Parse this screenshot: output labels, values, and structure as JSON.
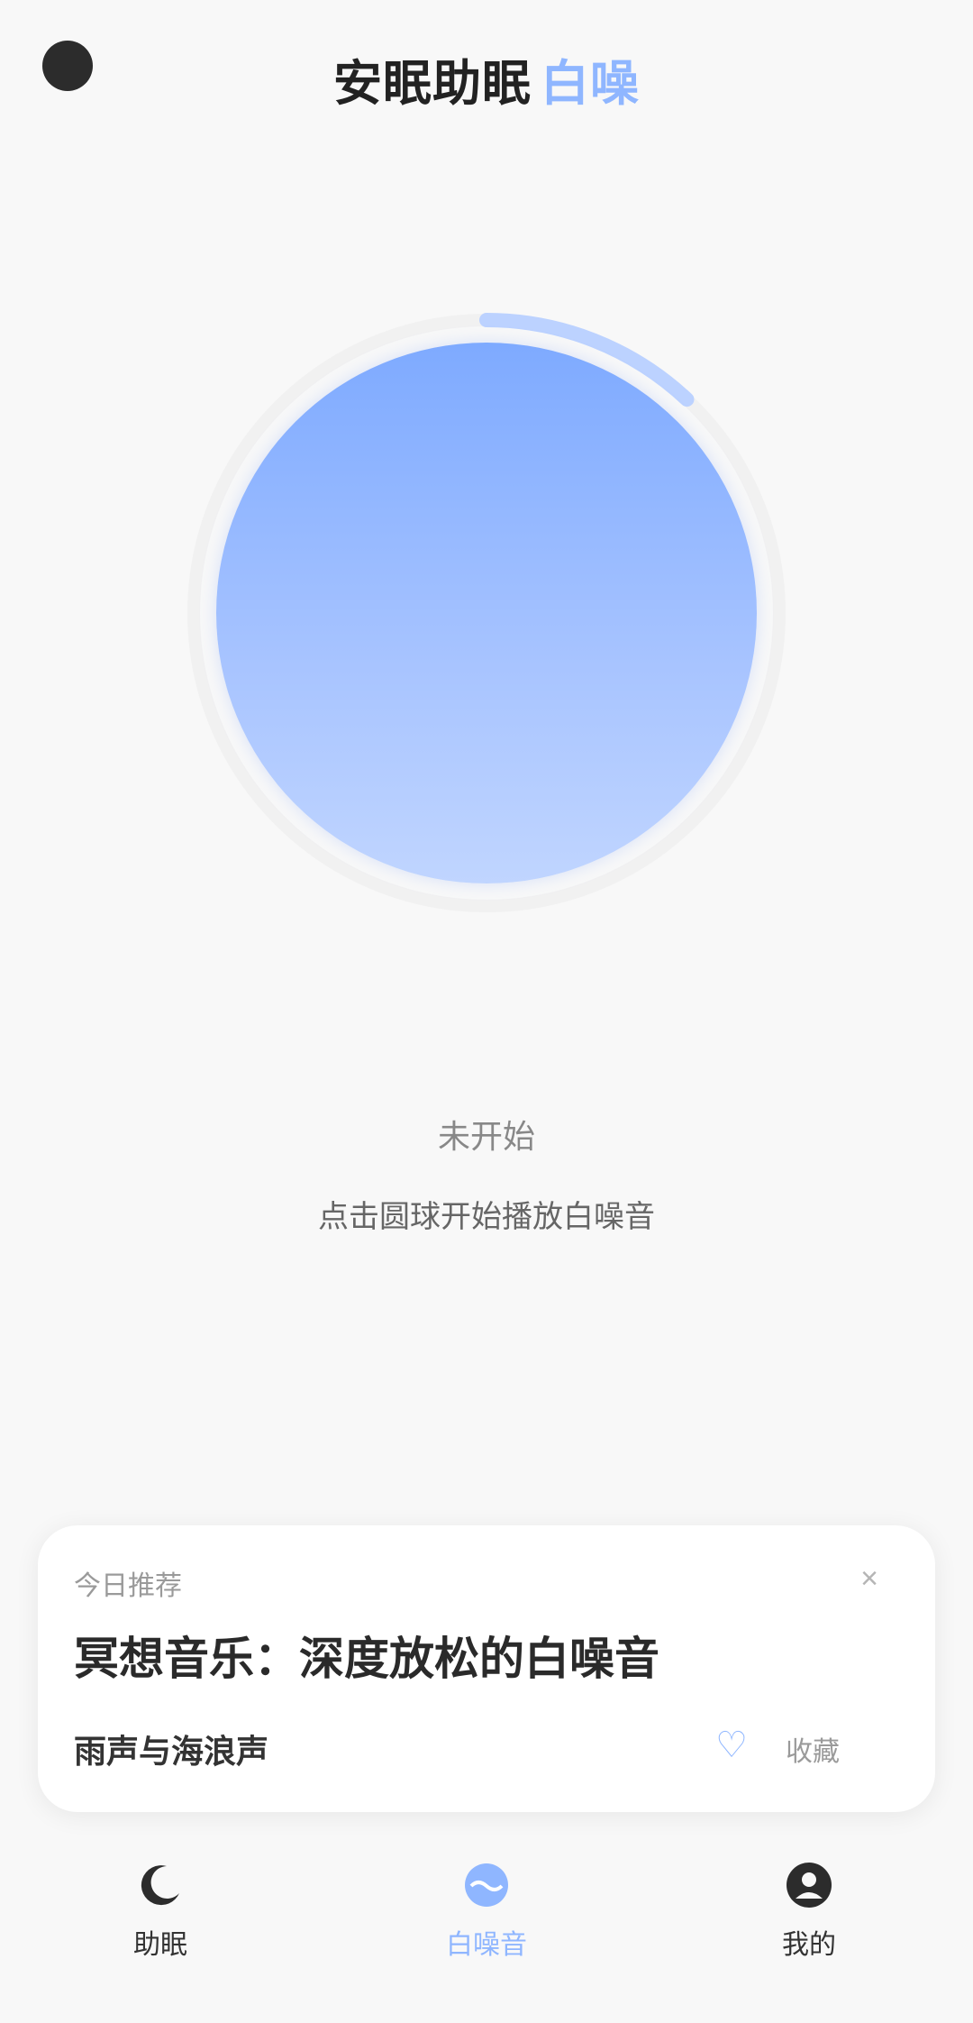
{
  "header": {
    "title": "安眠助眠",
    "title_accent": "白噪",
    "menu_icon": "profile-icon"
  },
  "orb": {
    "progress_fraction": 0.12,
    "accent_color": "#8fb6ff"
  },
  "status": {
    "line1": "未开始",
    "line2": "点击圆球开始播放白噪音"
  },
  "card": {
    "label": "今日推荐",
    "close_glyph": "×",
    "title": "冥想音乐：深度放松的白噪音",
    "desc": "雨声与海浪声",
    "action_glyph": "♡",
    "action_text": "收藏"
  },
  "nav": {
    "items": [
      {
        "label": "助眠",
        "icon": "moon-icon",
        "active": false
      },
      {
        "label": "白噪音",
        "icon": "wave-icon",
        "active": true
      },
      {
        "label": "我的",
        "icon": "user-icon",
        "active": false
      }
    ]
  },
  "colors": {
    "accent": "#8fb6ff",
    "orb_top": "#7eaaff",
    "orb_bottom": "#c0d5ff",
    "background": "#f8f8f8"
  }
}
